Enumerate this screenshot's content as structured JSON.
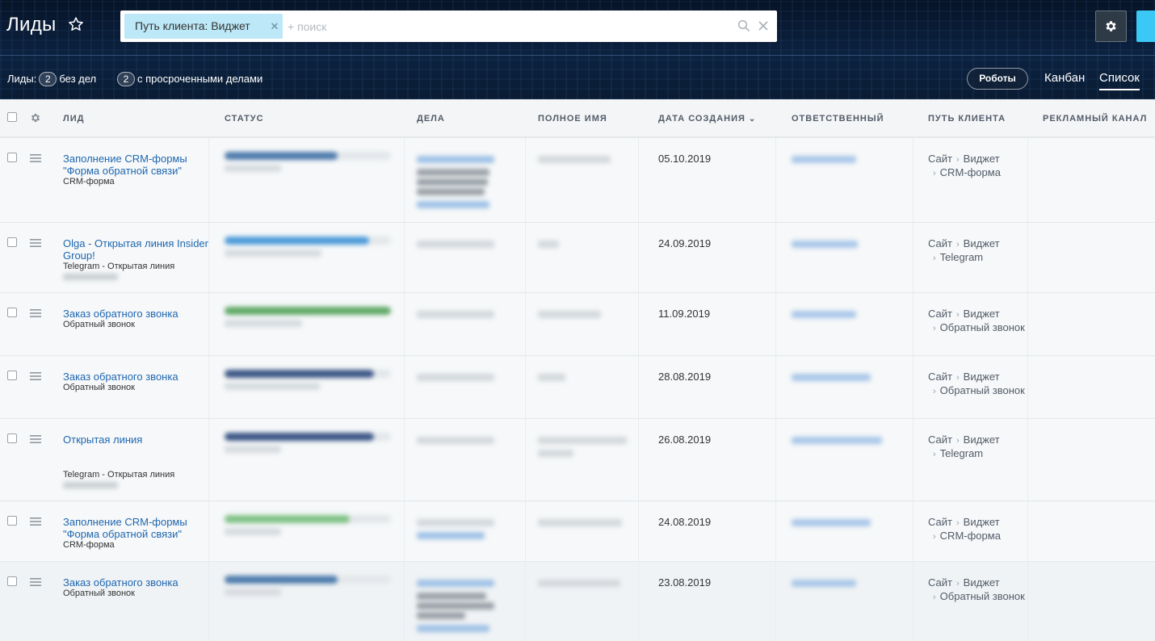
{
  "header": {
    "title": "Лиды",
    "filter_chip": "Путь клиента: Виджет",
    "search_placeholder": "+ поиск",
    "counters": [
      {
        "label": "Лиды:",
        "count": "2",
        "suffix": "без дел"
      },
      {
        "label": "",
        "count": "2",
        "suffix": "с просроченными делами"
      }
    ],
    "robots_label": "Роботы",
    "views": [
      "Канбан",
      "Список"
    ],
    "active_view": "Список"
  },
  "colors": {
    "accent": "#3bc8f5",
    "link": "#2067b0",
    "chip": "#bce8f7"
  },
  "grid": {
    "columns": [
      "Лид",
      "Статус",
      "Дела",
      "Полное имя",
      "Дата создания",
      "Ответственный",
      "Путь клиента",
      "Рекламный канал"
    ],
    "rows": [
      {
        "title": "Заполнение CRM-формы \"Форма обратной связи\"",
        "source": "CRM-форма",
        "status_fill": 0.68,
        "status_color": "#4d7aab",
        "date": "05.10.2019",
        "path": [
          "Сайт",
          "Виджет",
          "CRM-форма"
        ]
      },
      {
        "title": "Olga - Открытая линия Insider Group!",
        "source": "Telegram - Открытая линия",
        "status_fill": 0.87,
        "status_color": "#4b9ad8",
        "date": "24.09.2019",
        "path": [
          "Сайт",
          "Виджет",
          "Telegram"
        ]
      },
      {
        "title": "Заказ обратного звонка",
        "source": "Обратный звонок",
        "status_fill": 1.0,
        "status_color": "#5ea865",
        "date": "11.09.2019",
        "path": [
          "Сайт",
          "Виджет",
          "Обратный звонок"
        ]
      },
      {
        "title": "Заказ обратного звонка",
        "source": "Обратный звонок",
        "status_fill": 0.9,
        "status_color": "#3a5585",
        "date": "28.08.2019",
        "path": [
          "Сайт",
          "Виджет",
          "Обратный звонок"
        ]
      },
      {
        "title": "Открытая линия",
        "source": "Telegram - Открытая линия",
        "status_fill": 0.9,
        "status_color": "#3a5585",
        "date": "26.08.2019",
        "path": [
          "Сайт",
          "Виджет",
          "Telegram"
        ]
      },
      {
        "title": "Заполнение CRM-формы \"Форма обратной связи\"",
        "source": "CRM-форма",
        "status_fill": 0.75,
        "status_color": "#7fc184",
        "date": "24.08.2019",
        "path": [
          "Сайт",
          "Виджет",
          "CRM-форма"
        ]
      },
      {
        "title": "Заказ обратного звонка",
        "source": "Обратный звонок",
        "status_fill": 0.68,
        "status_color": "#4d7aab",
        "date": "23.08.2019",
        "path": [
          "Сайт",
          "Виджет",
          "Обратный звонок"
        ]
      }
    ]
  }
}
